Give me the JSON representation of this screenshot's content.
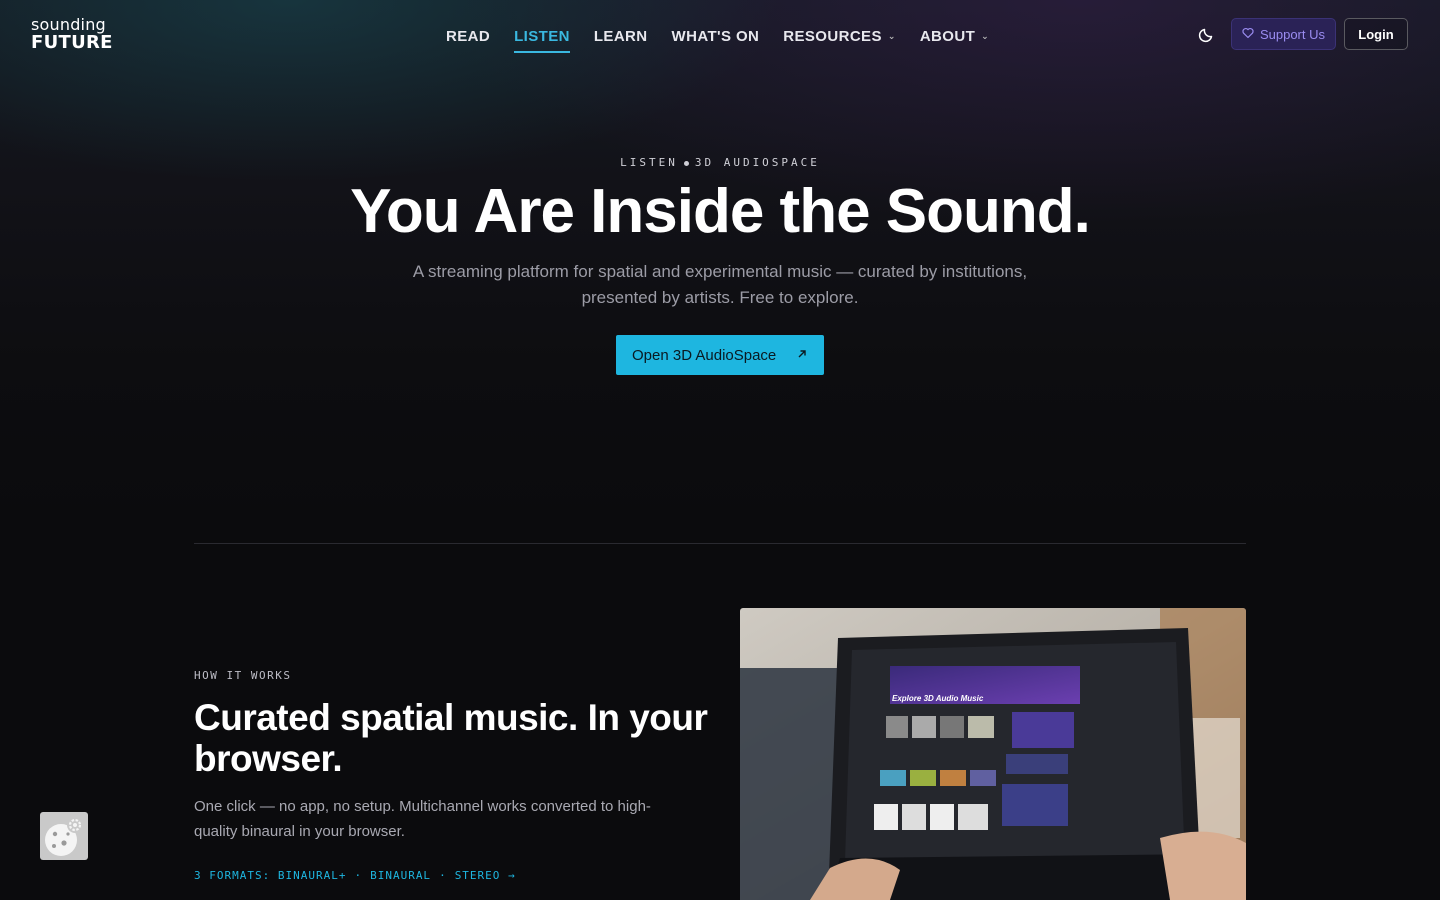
{
  "nav": {
    "logo_top": "sounding",
    "logo_bottom": "FUTURE",
    "items": [
      {
        "label": "READ",
        "active": false,
        "dropdown": false
      },
      {
        "label": "LISTEN",
        "active": true,
        "dropdown": false
      },
      {
        "label": "LEARN",
        "active": false,
        "dropdown": false
      },
      {
        "label": "WHAT'S ON",
        "active": false,
        "dropdown": false
      },
      {
        "label": "RESOURCES",
        "active": false,
        "dropdown": true
      },
      {
        "label": "ABOUT",
        "active": false,
        "dropdown": true
      }
    ],
    "theme_icon": "moon-icon",
    "support_label": "Support Us",
    "login_label": "Login"
  },
  "hero": {
    "eyebrow_left": "LISTEN",
    "eyebrow_right": "3D AUDIOSPACE",
    "title": "You Are Inside the Sound.",
    "subtitle_line1": "A streaming platform for spatial and experimental music — curated by institutions,",
    "subtitle_line2": "presented by artists. Free to explore.",
    "cta_label": "Open 3D AudioSpace",
    "cta_icon": "arrow-up-right-icon"
  },
  "how_it_works": {
    "eyebrow": "HOW IT WORKS",
    "title": "Curated spatial music. In your browser.",
    "body": "One click — no app, no setup. Multichannel works converted to high-quality binaural in your browser.",
    "formats": [
      "3 FORMATS: BINAURAL+",
      "·",
      "BINAURAL",
      "·",
      "STEREO →"
    ]
  },
  "photo": {
    "screen_title": "Explore 3D Audio Music"
  },
  "colors": {
    "accent": "#1eb6e0",
    "support_bg": "#2a2256",
    "support_text": "#9a8cf0",
    "background": "#0b0b0d"
  }
}
